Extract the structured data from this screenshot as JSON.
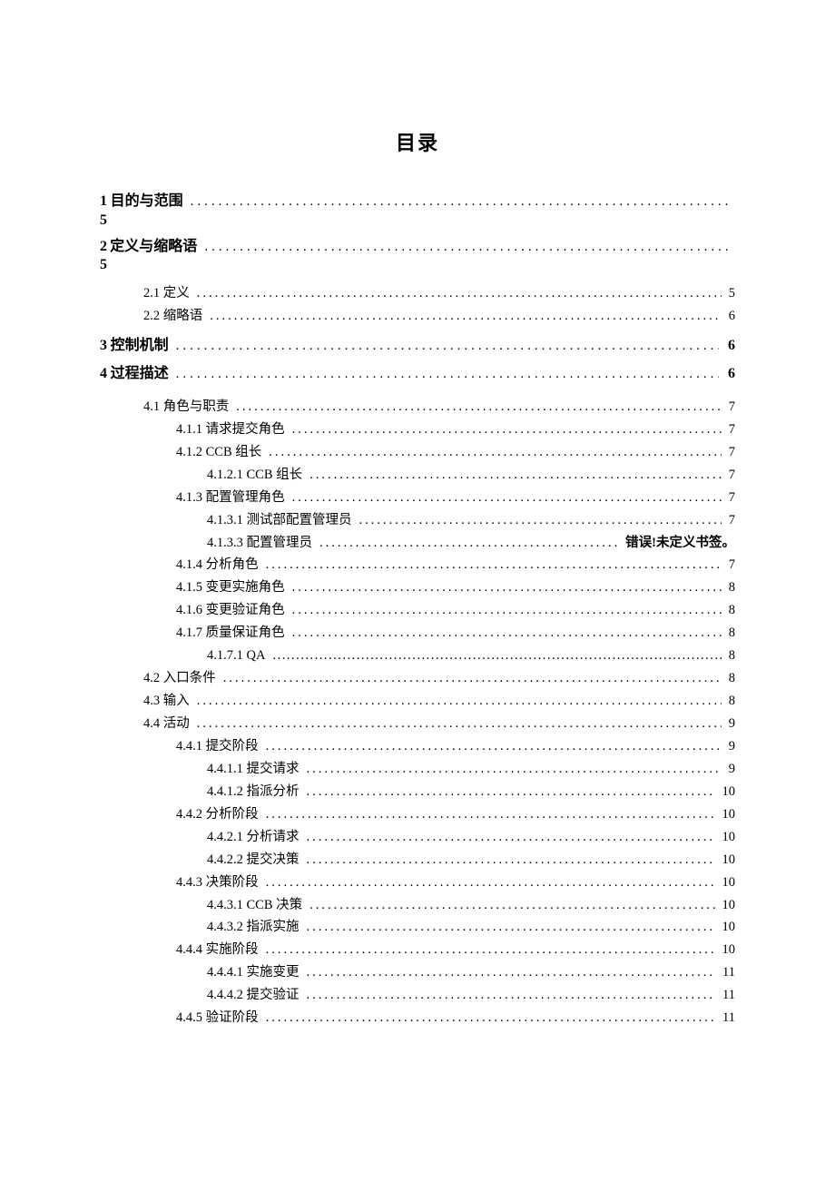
{
  "title": "目录",
  "toc": [
    {
      "lvl": 1,
      "num": "1",
      "label": "目的与范围",
      "page": "5",
      "pageWrap": true
    },
    {
      "lvl": 1,
      "num": "2",
      "label": "定义与缩略语",
      "page": "5",
      "pageWrap": true,
      "children": [
        {
          "lvl": 2,
          "label": "2.1 定义",
          "page": "5"
        },
        {
          "lvl": 2,
          "label": "2.2 缩略语",
          "page": "6"
        }
      ]
    },
    {
      "lvl": 1,
      "num": "3",
      "label": "控制机制",
      "page": "6"
    },
    {
      "lvl": 1,
      "num": "4",
      "label": "过程描述",
      "page": "6",
      "children": [
        {
          "lvl": 2,
          "label": "4.1 角色与职责",
          "page": "7"
        },
        {
          "lvl": 3,
          "label": "4.1.1 请求提交角色",
          "page": "7"
        },
        {
          "lvl": 3,
          "label": "4.1.2  CCB 组长",
          "page": "7"
        },
        {
          "lvl": 4,
          "label": "4.1.2.1  CCB 组长",
          "page": "7"
        },
        {
          "lvl": 3,
          "label": "4.1.3  配置管理角色",
          "page": "7"
        },
        {
          "lvl": 4,
          "label": "4.1.3.1  测试部配置管理员",
          "page": "7"
        },
        {
          "lvl": 4,
          "label": "4.1.3.3  配置管理员",
          "page": "错误!未定义书签。",
          "error": true
        },
        {
          "lvl": 3,
          "label": "4.1.4  分析角色",
          "page": "7"
        },
        {
          "lvl": 3,
          "label": "4.1.5  变更实施角色",
          "page": "8"
        },
        {
          "lvl": 3,
          "label": "4.1.6  变更验证角色",
          "page": "8"
        },
        {
          "lvl": 3,
          "label": "4.1.7  质量保证角色",
          "page": "8"
        },
        {
          "lvl": 4,
          "label": "4.1.7.1  QA",
          "page": "8",
          "qa": true
        },
        {
          "lvl": 2,
          "label": "4.2 入口条件",
          "page": "8"
        },
        {
          "lvl": 2,
          "label": "4.3 输入",
          "page": "8"
        },
        {
          "lvl": 2,
          "label": "4.4 活动",
          "page": "9"
        },
        {
          "lvl": 3,
          "label": "4.4.1 提交阶段",
          "page": "9"
        },
        {
          "lvl": 4,
          "label": "4.4.1.1  提交请求",
          "page": "9"
        },
        {
          "lvl": 4,
          "label": "4.4.1.2  指派分析",
          "page": "10"
        },
        {
          "lvl": 3,
          "label": "4.4.2 分析阶段",
          "page": "10"
        },
        {
          "lvl": 4,
          "label": "4.4.2.1  分析请求",
          "page": "10"
        },
        {
          "lvl": 4,
          "label": "4.4.2.2  提交决策",
          "page": "10"
        },
        {
          "lvl": 3,
          "label": "4.4.3 决策阶段",
          "page": "10"
        },
        {
          "lvl": 4,
          "label": "4.4.3.1  CCB 决策",
          "page": "10"
        },
        {
          "lvl": 4,
          "label": "4.4.3.2  指派实施",
          "page": "10"
        },
        {
          "lvl": 3,
          "label": "4.4.4 实施阶段",
          "page": "10"
        },
        {
          "lvl": 4,
          "label": "4.4.4.1  实施变更",
          "page": "11"
        },
        {
          "lvl": 4,
          "label": "4.4.4.2  提交验证",
          "page": "11"
        },
        {
          "lvl": 3,
          "label": "4.4.5 验证阶段",
          "page": "11"
        }
      ]
    }
  ]
}
